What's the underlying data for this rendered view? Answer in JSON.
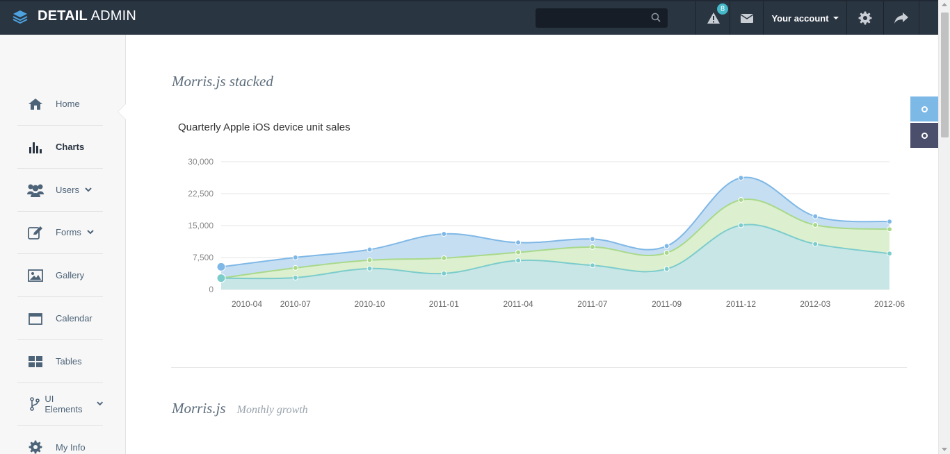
{
  "brand": {
    "bold": "DETAIL",
    "light": " ADMIN"
  },
  "header": {
    "search_placeholder": "",
    "alert_count": "8",
    "account_label": "Your account"
  },
  "sidebar": {
    "items": [
      {
        "label": "Home",
        "icon": "home-icon"
      },
      {
        "label": "Charts",
        "icon": "bar-chart-icon",
        "active": true
      },
      {
        "label": "Users",
        "icon": "users-icon",
        "dropdown": true
      },
      {
        "label": "Forms",
        "icon": "edit-icon",
        "dropdown": true
      },
      {
        "label": "Gallery",
        "icon": "image-icon"
      },
      {
        "label": "Calendar",
        "icon": "calendar-icon"
      },
      {
        "label": "Tables",
        "icon": "grid-icon"
      },
      {
        "label": "UI Elements",
        "icon": "fork-icon",
        "dropdown": true
      },
      {
        "label": "My Info",
        "icon": "gear-icon"
      }
    ]
  },
  "sections": {
    "stacked_title": "Morris.js stacked",
    "growth_title": "Morris.js",
    "growth_subtitle": "Monthly growth"
  },
  "chart_data": {
    "type": "area",
    "title": "Quarterly Apple iOS device unit sales",
    "xlabel": "",
    "ylabel": "",
    "ylim": [
      0,
      30000
    ],
    "yticks": [
      "0",
      "7,500",
      "15,000",
      "22,500",
      "30,000"
    ],
    "x": [
      "2010-Q1",
      "2010-Q2",
      "2010-Q3",
      "2010-Q4",
      "2011-Q1",
      "2011-Q2",
      "2011-Q3",
      "2011-Q4",
      "2012-Q1",
      "2012-Q2"
    ],
    "x_tick_labels": [
      "2010-04",
      "2010-07",
      "2010-10",
      "2011-01",
      "2011-04",
      "2011-07",
      "2011-09",
      "2011-12",
      "2012-03",
      "2012-06"
    ],
    "series": [
      {
        "name": "",
        "color": "#7ccccc",
        "values": [
          2666,
          2778,
          4912,
          3767,
          6810,
          5670,
          4820,
          15073,
          10687,
          8432
        ]
      },
      {
        "name": "",
        "color": "#a8d98a",
        "values": [
          0,
          2294,
          1969,
          3597,
          1914,
          4293,
          3795,
          5967,
          4460,
          5713
        ]
      },
      {
        "name": "",
        "color": "#7fb8e6",
        "values": [
          2647,
          2441,
          2501,
          5689,
          2293,
          1881,
          1588,
          5175,
          2028,
          1791
        ]
      }
    ]
  },
  "colors": {
    "topbar": "#2a3542",
    "accent": "#43b8c8",
    "sidebar_bg": "#f7f7f7"
  }
}
